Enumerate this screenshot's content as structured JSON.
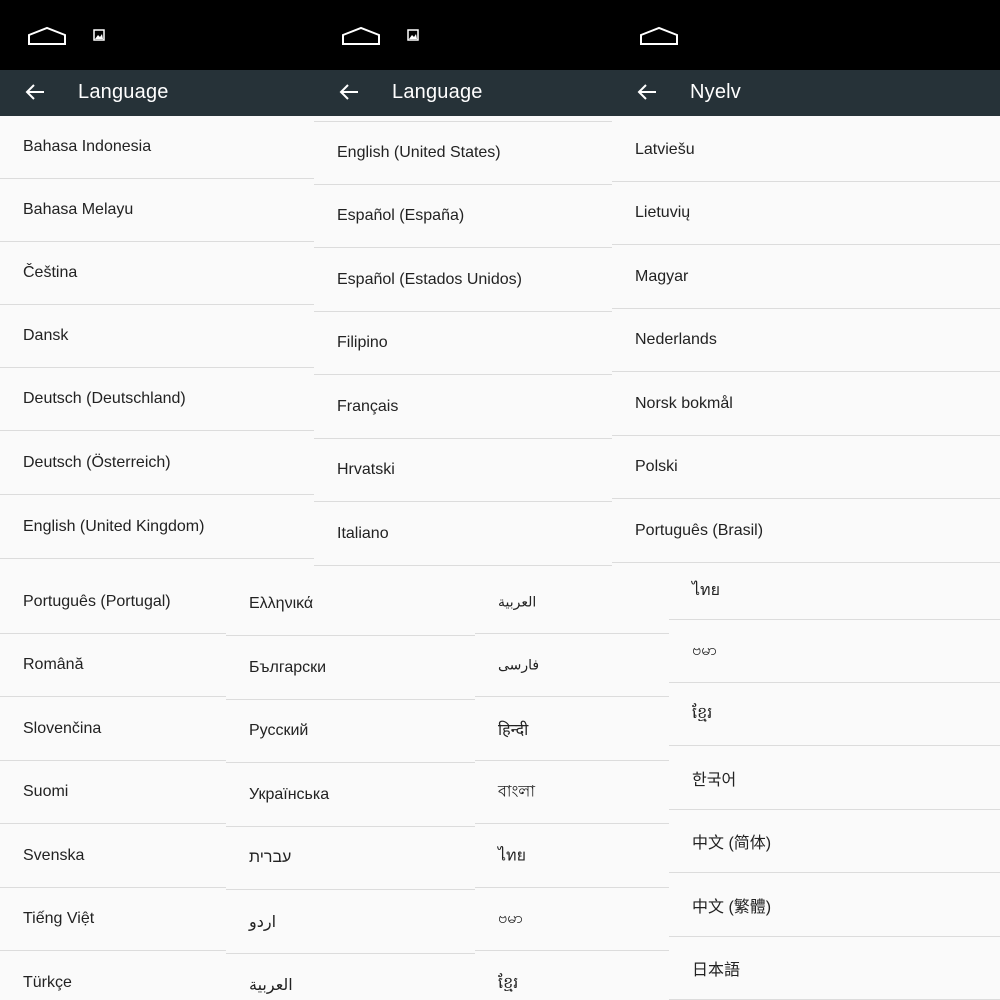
{
  "screens": [
    {
      "title": "Language",
      "languages": [
        "Bahasa Indonesia",
        "Bahasa Melayu",
        "Čeština",
        "Dansk",
        "Deutsch (Deutschland)",
        "Deutsch (Österreich)",
        "English (United Kingdom)"
      ]
    },
    {
      "title": "Language",
      "languages": [
        "English (United States)",
        "Español (España)",
        "Español (Estados Unidos)",
        "Filipino",
        "Français",
        "Hrvatski",
        "Italiano"
      ]
    },
    {
      "title": "Nyelv",
      "languages": [
        "Latviešu",
        "Lietuvių",
        "Magyar",
        "Nederlands",
        "Norsk bokmål",
        "Polski",
        "Português (Brasil)"
      ]
    }
  ],
  "lists": {
    "bottom_left": [
      "Português (Portugal)",
      "Română",
      "Slovenčina",
      "Suomi",
      "Svenska",
      "Tiếng Việt",
      "Türkçe"
    ],
    "bottom_mid": [
      "Ελληνικά",
      "Български",
      "Русский",
      "Українська",
      "עברית",
      "اردو",
      "العربية"
    ],
    "bottom_right_small": [
      "العربية",
      "فارسی",
      "हिन्दी",
      "বাংলা",
      "ไทย",
      "ဗမာ",
      "ខ្មែរ"
    ],
    "bottom_right": [
      "ไทย",
      "ဗမာ",
      "ខ្មែរ",
      "한국어",
      "中文 (简体)",
      "中文 (繁體)",
      "日本語"
    ]
  },
  "colors": {
    "status_bar": "#000000",
    "app_bar": "#263238",
    "list_bg": "#fafafa",
    "divider": "#dcdcdc",
    "text": "#222222"
  }
}
